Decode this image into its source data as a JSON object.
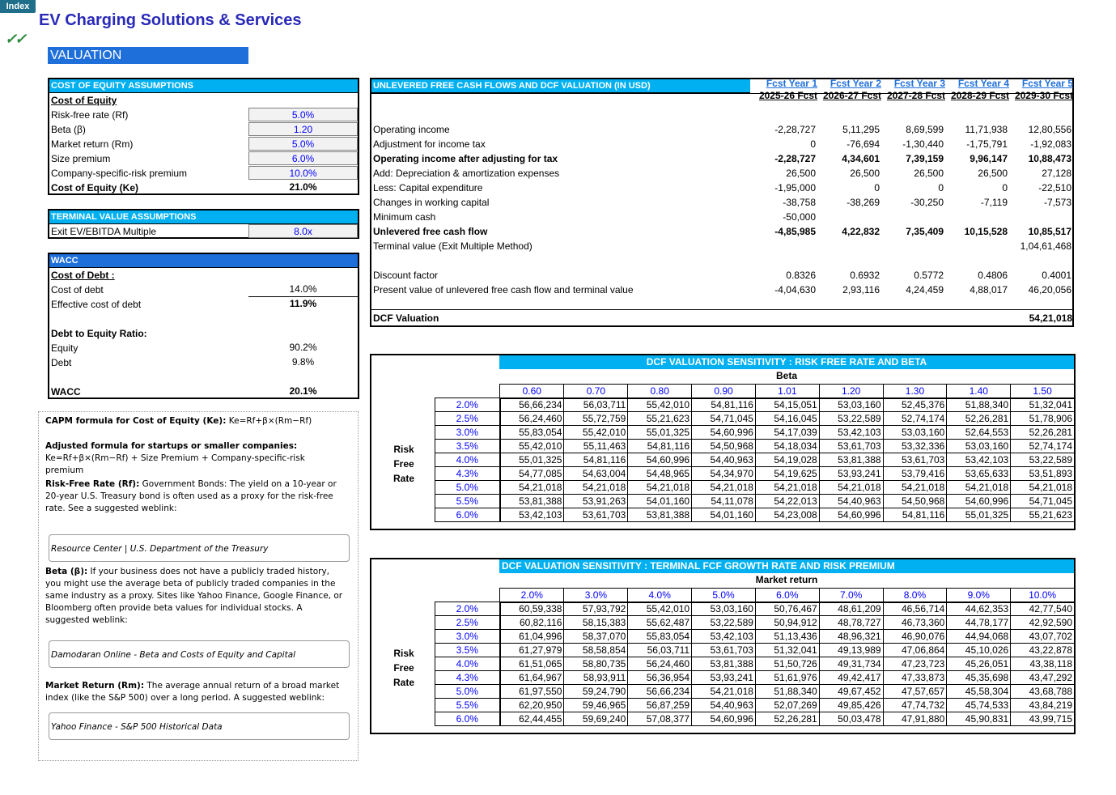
{
  "index_tab": "Index",
  "app_title": "EV Charging Solutions & Services",
  "checkmark": "✓✓",
  "section_title": "VALUATION",
  "coe": {
    "header": "COST OF EQUITY ASSUMPTIONS",
    "subheader": "Cost of Equity",
    "rows": [
      {
        "label": "Risk-free rate (Rf)",
        "value": "5.0%"
      },
      {
        "label": "Beta (β)",
        "value": "1.20"
      },
      {
        "label": "Market return (Rm)",
        "value": "5.0%"
      },
      {
        "label": "Size premium",
        "value": "6.0%"
      },
      {
        "label": "Company-specific-risk premium",
        "value": "10.0%"
      }
    ],
    "total_label": "Cost of Equity (Ke)",
    "total_value": "21.0%"
  },
  "tv": {
    "header": "TERMINAL VALUE ASSUMPTIONS",
    "label": "Exit EV/EBITDA Multiple",
    "value": "8.0x"
  },
  "wacc": {
    "header": "WACC",
    "cost_of_debt_label": "Cost of Debt :",
    "cost_label": "Cost of debt",
    "cost_value": "14.0%",
    "eff_label": "Effective cost of debt",
    "eff_value": "11.9%",
    "ratio_label": "Debt to Equity Ratio:",
    "equity_label": "Equity",
    "equity_value": "90.2%",
    "debt_label": "Debt",
    "debt_value": "9.8%",
    "wacc_label": "WACC",
    "wacc_value": "20.1%"
  },
  "notes": {
    "capm_bold": "CAPM formula for Cost of Equity (Ke):",
    "capm_text": " Ke=Rf+β×(Rm−Rf)",
    "adj_bold": "Adjusted formula for startups or smaller companies:",
    "adj_text": "Ke=Rf+β×(Rm−Rf) + Size Premium + Company-specific-risk premium",
    "rf_bold": "Risk-Free Rate (Rf):",
    "rf_text": " Government Bonds: The yield on a 10-year or 20-year U.S. Treasury bond is often used as a proxy for the risk-free rate. See a suggested weblink:",
    "link1": "Resource Center | U.S. Department of the Treasury",
    "beta_bold": "Beta (β):",
    "beta_text": " If your business does not have a publicly traded history, you might use the average beta of publicly traded companies in the same industry as a proxy. Sites like Yahoo Finance, Google Finance, or Bloomberg often provide beta values for individual stocks. A suggested weblink:",
    "link2": "Damodaran Online - Beta and Costs of Equity and Capital",
    "rm_bold": "Market Return (Rm):",
    "rm_text": " The average annual return of a broad market index (like the S&P 500) over a long period. A suggested weblink:",
    "link3": "Yahoo Finance - S&P 500 Historical Data"
  },
  "dcf": {
    "header": "UNLEVERED FREE CASH FLOWS AND DCF VALUATION (IN USD)",
    "years": [
      {
        "l1": "Fcst Year 1",
        "l2": "2025-26 Fcst"
      },
      {
        "l1": "Fcst Year 2",
        "l2": "2026-27 Fcst"
      },
      {
        "l1": "Fcst Year 3",
        "l2": "2027-28 Fcst"
      },
      {
        "l1": "Fcst Year 4",
        "l2": "2028-29 Fcst"
      },
      {
        "l1": "Fcst Year 5",
        "l2": "2029-30 Fcst"
      }
    ],
    "rows": [
      {
        "label": "Operating income",
        "bold": false,
        "values": [
          "-2,28,727",
          "5,11,295",
          "8,69,599",
          "11,71,938",
          "12,80,556"
        ]
      },
      {
        "label": "Adjustment for income tax",
        "bold": false,
        "values": [
          "0",
          "-76,694",
          "-1,30,440",
          "-1,75,791",
          "-1,92,083"
        ]
      },
      {
        "label": "Operating income after adjusting for tax",
        "bold": true,
        "values": [
          "-2,28,727",
          "4,34,601",
          "7,39,159",
          "9,96,147",
          "10,88,473"
        ]
      },
      {
        "label": "Add: Depreciation & amortization expenses",
        "bold": false,
        "values": [
          "26,500",
          "26,500",
          "26,500",
          "26,500",
          "27,128"
        ]
      },
      {
        "label": "Less: Capital expenditure",
        "bold": false,
        "values": [
          "-1,95,000",
          "0",
          "0",
          "0",
          "-22,510"
        ]
      },
      {
        "label": "Changes in working capital",
        "bold": false,
        "values": [
          "-38,758",
          "-38,269",
          "-30,250",
          "-7,119",
          "-7,573"
        ]
      },
      {
        "label": "Minimum cash",
        "bold": false,
        "values": [
          "-50,000",
          "",
          "",
          "",
          ""
        ]
      },
      {
        "label": "Unlevered free cash flow",
        "bold": true,
        "values": [
          "-4,85,985",
          "4,22,832",
          "7,35,409",
          "10,15,528",
          "10,85,517"
        ]
      },
      {
        "label": "Terminal value (Exit Multiple Method)",
        "bold": false,
        "values": [
          "",
          "",
          "",
          "",
          "1,04,61,468"
        ]
      }
    ],
    "discount_label": "Discount factor",
    "discount_values": [
      "0.8326",
      "0.6932",
      "0.5772",
      "0.4806",
      "0.4001"
    ],
    "pv_label": "Present value of unlevered free cash flow and terminal value",
    "pv_values": [
      "-4,04,630",
      "2,93,116",
      "4,24,459",
      "4,88,017",
      "46,20,056"
    ],
    "valuation_label": "DCF Valuation",
    "valuation_value": "54,21,018"
  },
  "sens1": {
    "title": "DCF VALUATION SENSITIVITY : RISK FREE RATE AND BETA",
    "col_axis": "Beta",
    "row_axis": [
      "Risk",
      "Free",
      "Rate"
    ],
    "cols": [
      "0.60",
      "0.70",
      "0.80",
      "0.90",
      "1.01",
      "1.20",
      "1.30",
      "1.40",
      "1.50"
    ],
    "rows": [
      {
        "k": "2.0%",
        "v": [
          "56,66,234",
          "56,03,711",
          "55,42,010",
          "54,81,116",
          "54,15,051",
          "53,03,160",
          "52,45,376",
          "51,88,340",
          "51,32,041"
        ]
      },
      {
        "k": "2.5%",
        "v": [
          "56,24,460",
          "55,72,759",
          "55,21,623",
          "54,71,045",
          "54,16,045",
          "53,22,589",
          "52,74,174",
          "52,26,281",
          "51,78,906"
        ]
      },
      {
        "k": "3.0%",
        "v": [
          "55,83,054",
          "55,42,010",
          "55,01,325",
          "54,60,996",
          "54,17,039",
          "53,42,103",
          "53,03,160",
          "52,64,553",
          "52,26,281"
        ]
      },
      {
        "k": "3.5%",
        "v": [
          "55,42,010",
          "55,11,463",
          "54,81,116",
          "54,50,968",
          "54,18,034",
          "53,61,703",
          "53,32,336",
          "53,03,160",
          "52,74,174"
        ]
      },
      {
        "k": "4.0%",
        "v": [
          "55,01,325",
          "54,81,116",
          "54,60,996",
          "54,40,963",
          "54,19,028",
          "53,81,388",
          "53,61,703",
          "53,42,103",
          "53,22,589"
        ]
      },
      {
        "k": "4.3%",
        "v": [
          "54,77,085",
          "54,63,004",
          "54,48,965",
          "54,34,970",
          "54,19,625",
          "53,93,241",
          "53,79,416",
          "53,65,633",
          "53,51,893"
        ]
      },
      {
        "k": "5.0%",
        "v": [
          "54,21,018",
          "54,21,018",
          "54,21,018",
          "54,21,018",
          "54,21,018",
          "54,21,018",
          "54,21,018",
          "54,21,018",
          "54,21,018"
        ]
      },
      {
        "k": "5.5%",
        "v": [
          "53,81,388",
          "53,91,263",
          "54,01,160",
          "54,11,078",
          "54,22,013",
          "54,40,963",
          "54,50,968",
          "54,60,996",
          "54,71,045"
        ]
      },
      {
        "k": "6.0%",
        "v": [
          "53,42,103",
          "53,61,703",
          "53,81,388",
          "54,01,160",
          "54,23,008",
          "54,60,996",
          "54,81,116",
          "55,01,325",
          "55,21,623"
        ]
      }
    ]
  },
  "sens2": {
    "title": "DCF VALUATION SENSITIVITY : TERMINAL FCF GROWTH RATE AND RISK PREMIUM",
    "col_axis": "Market return",
    "row_axis": [
      "Risk",
      "Free",
      "Rate"
    ],
    "cols": [
      "2.0%",
      "3.0%",
      "4.0%",
      "5.0%",
      "6.0%",
      "7.0%",
      "8.0%",
      "9.0%",
      "10.0%"
    ],
    "rows": [
      {
        "k": "2.0%",
        "v": [
          "60,59,338",
          "57,93,792",
          "55,42,010",
          "53,03,160",
          "50,76,467",
          "48,61,209",
          "46,56,714",
          "44,62,353",
          "42,77,540"
        ]
      },
      {
        "k": "2.5%",
        "v": [
          "60,82,116",
          "58,15,383",
          "55,62,487",
          "53,22,589",
          "50,94,912",
          "48,78,727",
          "46,73,360",
          "44,78,177",
          "42,92,590"
        ]
      },
      {
        "k": "3.0%",
        "v": [
          "61,04,996",
          "58,37,070",
          "55,83,054",
          "53,42,103",
          "51,13,436",
          "48,96,321",
          "46,90,076",
          "44,94,068",
          "43,07,702"
        ]
      },
      {
        "k": "3.5%",
        "v": [
          "61,27,979",
          "58,58,854",
          "56,03,711",
          "53,61,703",
          "51,32,041",
          "49,13,989",
          "47,06,864",
          "45,10,026",
          "43,22,878"
        ]
      },
      {
        "k": "4.0%",
        "v": [
          "61,51,065",
          "58,80,735",
          "56,24,460",
          "53,81,388",
          "51,50,726",
          "49,31,734",
          "47,23,723",
          "45,26,051",
          "43,38,118"
        ]
      },
      {
        "k": "4.3%",
        "v": [
          "61,64,967",
          "58,93,911",
          "56,36,954",
          "53,93,241",
          "51,61,976",
          "49,42,417",
          "47,33,873",
          "45,35,698",
          "43,47,292"
        ]
      },
      {
        "k": "5.0%",
        "v": [
          "61,97,550",
          "59,24,790",
          "56,66,234",
          "54,21,018",
          "51,88,340",
          "49,67,452",
          "47,57,657",
          "45,58,304",
          "43,68,788"
        ]
      },
      {
        "k": "5.5%",
        "v": [
          "62,20,950",
          "59,46,965",
          "56,87,259",
          "54,40,963",
          "52,07,269",
          "49,85,426",
          "47,74,732",
          "45,74,533",
          "43,84,219"
        ]
      },
      {
        "k": "6.0%",
        "v": [
          "62,44,455",
          "59,69,240",
          "57,08,377",
          "54,60,996",
          "52,26,281",
          "50,03,478",
          "47,91,880",
          "45,90,831",
          "43,99,715"
        ]
      }
    ]
  }
}
